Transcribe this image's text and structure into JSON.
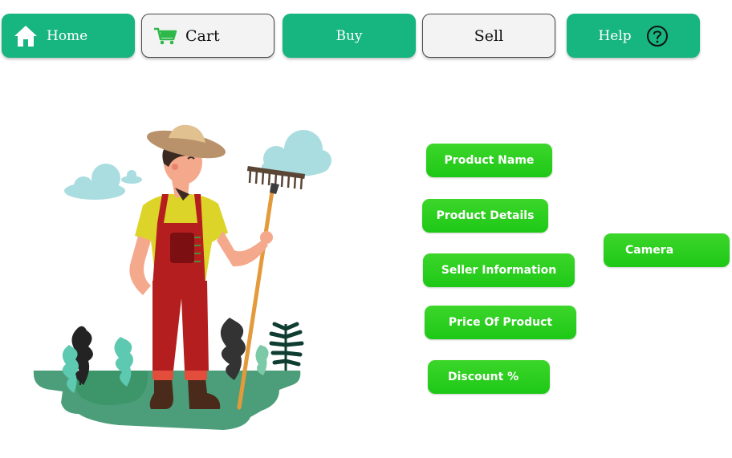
{
  "nav": {
    "home_label": "Home",
    "cart_label": "Cart",
    "buy_label": "Buy",
    "sell_label": "Sell",
    "help_label": "Help"
  },
  "form_fields": {
    "product_name": "Product Name",
    "product_details": "Product Details",
    "seller_information": "Seller Information",
    "price_of_product": "Price Of Product",
    "discount": "Discount %",
    "camera": "Camera"
  },
  "colors": {
    "nav_green": "#17b57f",
    "nav_gray": "#f3f3f3",
    "field_green": "#2ccf20",
    "ground_green": "#4c9e7a"
  },
  "icons": {
    "home": "home-icon",
    "cart": "cart-icon",
    "help": "question-circle-icon"
  }
}
